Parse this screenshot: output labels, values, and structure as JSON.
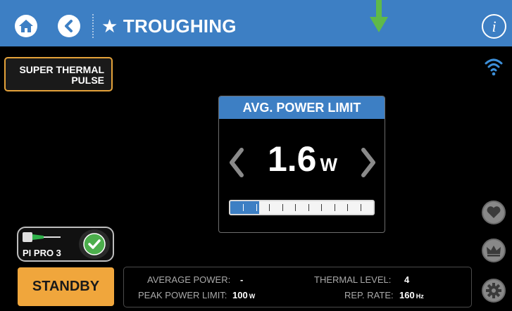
{
  "header": {
    "title": "★ TROUGHING",
    "icons": [
      "home-icon",
      "back-icon",
      "info-icon"
    ],
    "info_label": "i",
    "accent": "#3d7fc4",
    "marker_color": "#5fb94a"
  },
  "mode_button": {
    "line1": "SUPER THERMAL",
    "line2": "PULSE"
  },
  "panel": {
    "title": "AVG. POWER LIMIT",
    "value": "1.6",
    "unit": "W",
    "level_fraction": 0.2,
    "segments": 10
  },
  "tip": {
    "name": "PI PRO 3",
    "status": "connected"
  },
  "standby_label": "STANDBY",
  "status_bar": {
    "average_power_label": "AVERAGE POWER:",
    "average_power_value": "-",
    "peak_power_limit_label": "PEAK POWER LIMIT:",
    "peak_power_limit_value": "100",
    "peak_power_limit_unit": "W",
    "thermal_level_label": "THERMAL LEVEL:",
    "thermal_level_value": "4",
    "rep_rate_label": "REP. RATE:",
    "rep_rate_value": "160",
    "rep_rate_unit": "Hz"
  },
  "side_icons": [
    "heart-icon",
    "crown-icon",
    "gear-icon"
  ],
  "colors": {
    "standby": "#f0a63c",
    "check": "#4cae4c",
    "tip_green": "#2fb24a"
  }
}
